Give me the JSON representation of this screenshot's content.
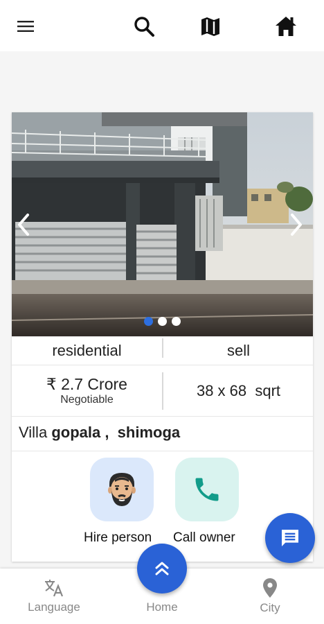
{
  "header": {
    "menu_icon": "hamburger-menu-icon",
    "search_icon": "search-icon",
    "map_icon": "map-icon",
    "home_icon": "home-icon"
  },
  "listing": {
    "carousel": {
      "slide_count": 3,
      "active_slide": 1,
      "prev_icon": "chevron-left-icon",
      "next_icon": "chevron-right-icon"
    },
    "category": "residential",
    "deal_type": "sell",
    "price": "₹ 2.7 Crore",
    "price_note": "Negotiable",
    "size": "38 x 68  sqrt",
    "property_type": "Villa",
    "location": "gopala ,  shimoga"
  },
  "actions": {
    "hire_label": "Hire person",
    "call_label": "Call owner"
  },
  "bottom_nav": {
    "language_label": "Language",
    "home_label": "Home",
    "city_label": "City"
  },
  "colors": {
    "accent": "#2a62d6",
    "hire_bg": "#dbe8fb",
    "call_bg": "#d9f3ef",
    "phone": "#129c8a"
  }
}
